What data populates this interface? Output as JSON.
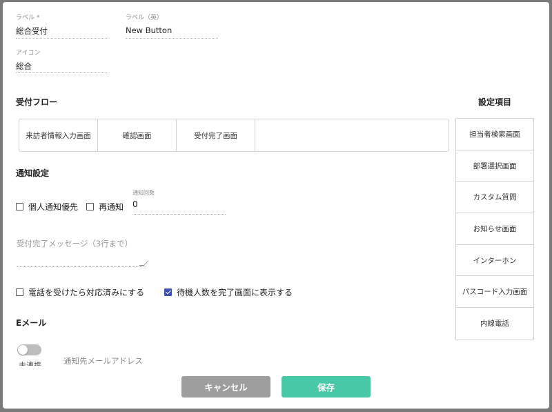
{
  "fields": {
    "label": {
      "label": "ラベル *",
      "value": "総合受付"
    },
    "label_en": {
      "label": "ラベル（英）",
      "value": "New Button"
    },
    "icon": {
      "label": "アイコン",
      "value": "総合"
    }
  },
  "flow": {
    "title": "受付フロー",
    "steps": [
      "来訪者情報入力画面",
      "確認画面",
      "受付完了画面"
    ]
  },
  "settings": {
    "title": "設定項目",
    "items": [
      "担当者検索画面",
      "部署選択画面",
      "カスタム質問",
      "お知らせ画面",
      "インターホン",
      "パスコード入力画面",
      "内線電話"
    ]
  },
  "notification": {
    "title": "通知設定",
    "personal_priority": {
      "label": "個人通知優先",
      "checked": false
    },
    "renotify": {
      "label": "再通知",
      "checked": false
    },
    "count": {
      "label": "通知回数",
      "value": "0"
    },
    "message_placeholder": "受付完了メッセージ（3行まで）",
    "phone_done": {
      "label": "電話を受けたら対応済みにする",
      "checked": false
    },
    "show_waiting": {
      "label": "待機人数を完了画面に表示する",
      "checked": true
    }
  },
  "email": {
    "title": "Eメール",
    "toggle_label": "未連携",
    "address_placeholder": "通知先メールアドレス"
  },
  "buttons": {
    "cancel": "キャンセル",
    "save": "保存"
  },
  "colors": {
    "accent": "#3f51b5",
    "save": "#48c8a6",
    "cancel": "#9e9e9e"
  }
}
